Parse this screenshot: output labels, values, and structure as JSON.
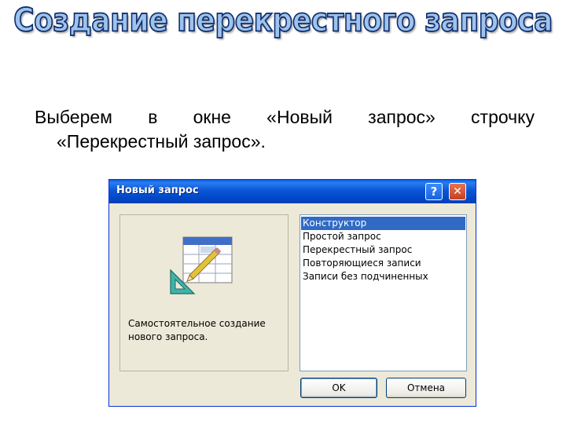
{
  "slide": {
    "title": "Создание перекрестного запроса",
    "instruction_line1_words": [
      "Выберем",
      "в",
      "окне",
      "«Новый",
      "запрос»",
      "строчку"
    ],
    "instruction_line2": "«Перекрестный запрос»."
  },
  "dialog": {
    "title": "Новый запрос",
    "help_button": "?",
    "close_button": "✕",
    "description": "Самостоятельное создание нового запроса.",
    "icon": "query-design-icon",
    "list_items": [
      {
        "label": "Конструктор",
        "selected": true
      },
      {
        "label": "Простой запрос",
        "selected": false
      },
      {
        "label": "Перекрестный запрос",
        "selected": false
      },
      {
        "label": "Повторяющиеся записи",
        "selected": false
      },
      {
        "label": "Записи без подчиненных",
        "selected": false
      }
    ],
    "ok_label": "OK",
    "cancel_label": "Отмена"
  },
  "colors": {
    "title_fill": "#9ec3ec",
    "title_outline": "#0f2e6e",
    "titlebar_blue": "#0b56d6",
    "selection": "#316ac5",
    "dialog_face": "#ece9d8"
  }
}
